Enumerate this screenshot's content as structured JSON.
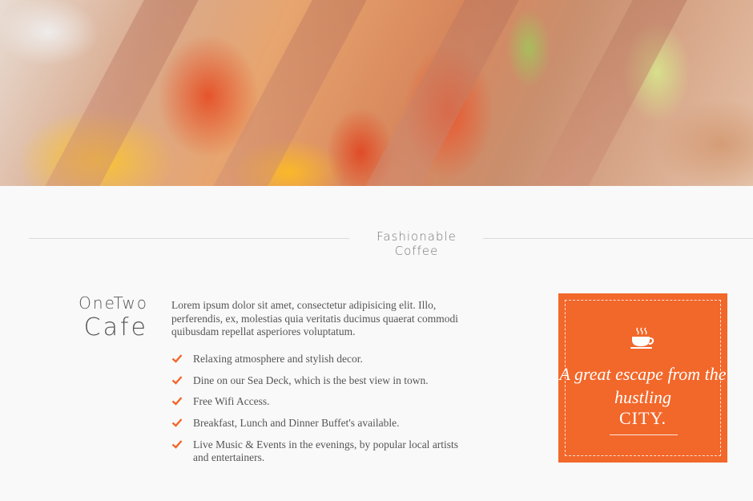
{
  "hero": {
    "image_name": "club-sandwich-photo"
  },
  "section": {
    "title": "Fashionable Coffee"
  },
  "brand": {
    "line1": "OneTwo",
    "line2": "Cafe"
  },
  "intro": {
    "text": "Lorem ipsum dolor sit amet, consectetur adipisicing elit. Illo, perferendis, ex, molestias quia veritatis ducimus quaerat commodi quibusdam repellat asperiores voluptatum."
  },
  "features": [
    "Relaxing atmosphere and stylish decor.",
    "Dine on our Sea Deck, which is the best view in town.",
    "Free Wifi Access.",
    "Breakfast, Lunch and Dinner Buffet's available.",
    "Live Music & Events in the evenings, by popular local artists and entertainers."
  ],
  "promo": {
    "icon": "coffee-cup-icon",
    "tagline": "A great escape from the hustling",
    "city": "CITY."
  },
  "colors": {
    "accent": "#f2672a",
    "background": "#f9f9f9",
    "text": "#555555"
  }
}
